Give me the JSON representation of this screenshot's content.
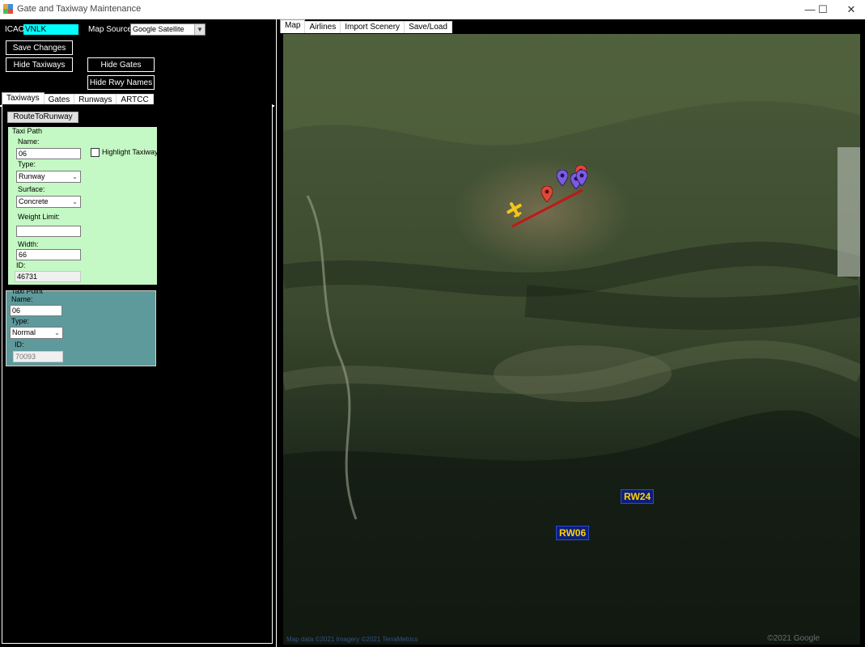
{
  "window": {
    "title": "Gate and Taxiway Maintenance",
    "minimize_glyph": "—",
    "maximize_glyph": "☐",
    "close_glyph": "✕"
  },
  "left": {
    "icao_label": "ICAO:",
    "icao_value": "VNLK",
    "map_source_label": "Map Source:",
    "map_source_value": "Google Satellite",
    "save_changes": "Save Changes",
    "hide_taxiways": "Hide Taxiways",
    "hide_gates": "Hide Gates",
    "hide_rwy_names": "Hide Rwy Names",
    "tabs": [
      "Taxiways",
      "Gates",
      "Runways",
      "ARTCC"
    ],
    "route_button": "RouteToRunway",
    "taxi_path": {
      "legend": "Taxi Path",
      "name_label": "Name:",
      "name_value": "06",
      "highlight_label": "Highlight Taxiway",
      "type_label": "Type:",
      "type_value": "Runway",
      "surface_label": "Surface:",
      "surface_value": "Concrete",
      "weight_label": "Weight Limit:",
      "weight_value": "",
      "width_label": "Width:",
      "width_value": "66",
      "id_label": "ID:",
      "id_value": "46731"
    },
    "taxi_point": {
      "legend": "Taxi Point",
      "name_label": "Name:",
      "name_value": "06",
      "type_label": "Type:",
      "type_value": "Normal",
      "id_label": "ID:",
      "id_value": "70093"
    }
  },
  "right": {
    "tabs": [
      "Map",
      "Airlines",
      "Import Scenery",
      "Save/Load"
    ],
    "runway_labels": [
      "RW24",
      "RW06"
    ],
    "footer_text": "Map data ©2021 Imagery ©2021 TerraMetrics",
    "copyright": "©2021 Google"
  },
  "colors": {
    "icao_bg": "#00ffff",
    "taxi_path_bg": "#c4f8c4",
    "taxi_point_bg": "#5e9a9c",
    "runway_line": "#c01818",
    "marker_red": "#e0483a",
    "marker_purple": "#7b5ce0",
    "runway_label_bg": "#0d1f7a",
    "runway_label_text": "#ffd200"
  }
}
